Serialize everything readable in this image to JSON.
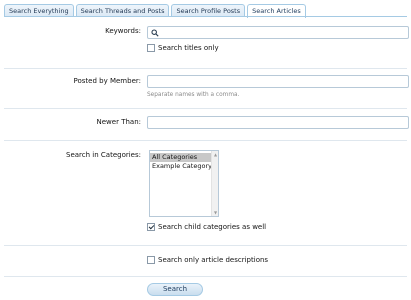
{
  "tabs": [
    {
      "label": "Search Everything"
    },
    {
      "label": "Search Threads and Posts"
    },
    {
      "label": "Search Profile Posts"
    },
    {
      "label": "Search Articles"
    }
  ],
  "keywords": {
    "label": "Keywords:",
    "value": "",
    "icon": "search-icon",
    "titles_only": {
      "label": "Search titles only",
      "checked": false
    }
  },
  "member": {
    "label": "Posted by Member:",
    "value": "",
    "hint": "Separate names with a comma."
  },
  "newer_than": {
    "label": "Newer Than:",
    "value": ""
  },
  "categories": {
    "label": "Search in Categories:",
    "options": [
      "All Categories",
      "Example Category"
    ],
    "selected": "All Categories",
    "child_categories": {
      "label": "Search child categories as well",
      "checked": true
    }
  },
  "descriptions_only": {
    "label": "Search only article descriptions",
    "checked": false
  },
  "submit": {
    "label": "Search"
  },
  "colors": {
    "tab_border": "#a5cae4",
    "button_text": "#1d3a5c"
  }
}
